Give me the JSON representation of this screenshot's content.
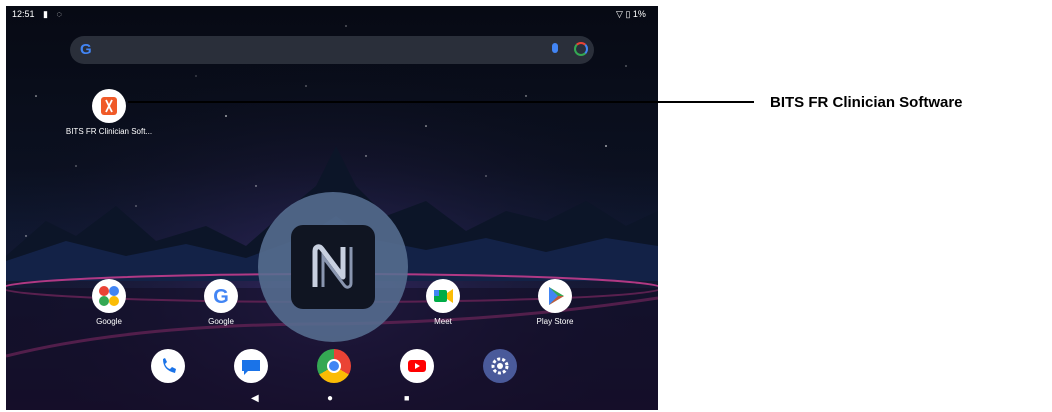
{
  "status_bar": {
    "time": "12:51",
    "battery": "1%"
  },
  "search_bar": {
    "logo": "G"
  },
  "desktop_app": {
    "label": "BITS FR Clinician Soft...",
    "icon": "bits-fr-clinician-icon"
  },
  "home_apps": [
    {
      "label": "Google",
      "icon": "google-folder-icon"
    },
    {
      "label": "Google",
      "icon": "google-g-icon"
    },
    {
      "label": "Meet",
      "icon": "meet-icon"
    },
    {
      "label": "Play Store",
      "icon": "play-store-icon"
    }
  ],
  "dock_apps": [
    {
      "icon": "phone-icon"
    },
    {
      "icon": "messages-icon"
    },
    {
      "icon": "chrome-icon"
    },
    {
      "icon": "youtube-icon"
    },
    {
      "icon": "settings-icon"
    }
  ],
  "nav_bar": {
    "back": "◀",
    "home": "●",
    "recents": "■"
  },
  "overlay": {
    "icon": "nfc-icon"
  },
  "callout": {
    "text": "BITS FR Clinician Software"
  },
  "colors": {
    "bits_orange": "#F05A28",
    "google_blue": "#4285F4",
    "meet_green": "#00AC47",
    "youtube_red": "#FF0000"
  }
}
